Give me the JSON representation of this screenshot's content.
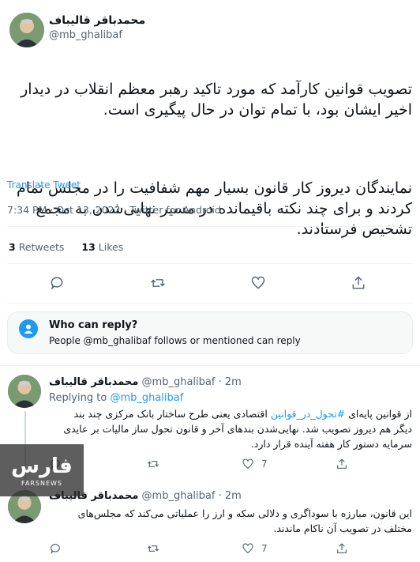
{
  "main_tweet": {
    "author_name": "محمدباقر قالیباف",
    "author_handle": "@mb_ghalibaf",
    "text_p1": "تصویب قوانین کارآمد که مورد تاکید رهبر معظم انقلاب در دیدار اخیر ایشان بود، با تمام توان در حال پیگیری است.",
    "text_p2": "نمایندگان دیروز کار قانون بسیار مهم شفافیت را در مجلس تمام کردند و برای چند نکته باقیمانده در مسیر نهایی‌شدن به مجمع تشخیص فرستادند.",
    "translate_label": "Translate Tweet",
    "timestamp": "7:34 PM · Oct 13, 2022 · Twitter for Android",
    "retweets_count": "3",
    "retweets_label": "Retweets",
    "likes_count": "13",
    "likes_label": "Likes"
  },
  "who_can_reply": {
    "title": "Who can reply?",
    "description": "People @mb_ghalibaf follows or mentioned can reply"
  },
  "replies": [
    {
      "author_name": "محمدباقر قالیباف",
      "author_handle": "@mb_ghalibaf",
      "time": "· 2m",
      "replying_to_label": "Replying to",
      "replying_to_handle": "@mb_ghalibaf",
      "text_line1_a": "از قوانین پایه‌ای ",
      "text_line1_hashtag": "#تحول_در_قوانین",
      "text_line1_b": " اقتصادی یعنی طرح ساختار بانک مرکزی چند بند",
      "text_rest": "دیگر هم دیروز تصویب شد. نهایی‌شدن بندهای آخر و قانون تحول ساز  مالیات بر عایدی سرمایه  دستور کار هفته آینده قرار دارد.",
      "like_count": "7"
    },
    {
      "author_name": "محمدباقر قالیباف",
      "author_handle": "@mb_ghalibaf",
      "time": "· 2m",
      "text": "این قانون، مبارزه با سوداگری و دلالی سکه و ارز را عملیاتی می‌کند که مجلس‌های مختلف در تصویب آن ناکام ماندند.",
      "like_count": "7"
    }
  ],
  "watermark": {
    "logo_text": "فارس",
    "caption": "FARSNEWS"
  },
  "icons": {
    "reply": "comment-icon",
    "retweet": "retweet-icon",
    "like": "heart-icon",
    "share": "share-icon",
    "person": "person-icon"
  },
  "colors": {
    "accent": "#1d9bf0",
    "muted": "#536471",
    "divider": "#eff3f4"
  }
}
